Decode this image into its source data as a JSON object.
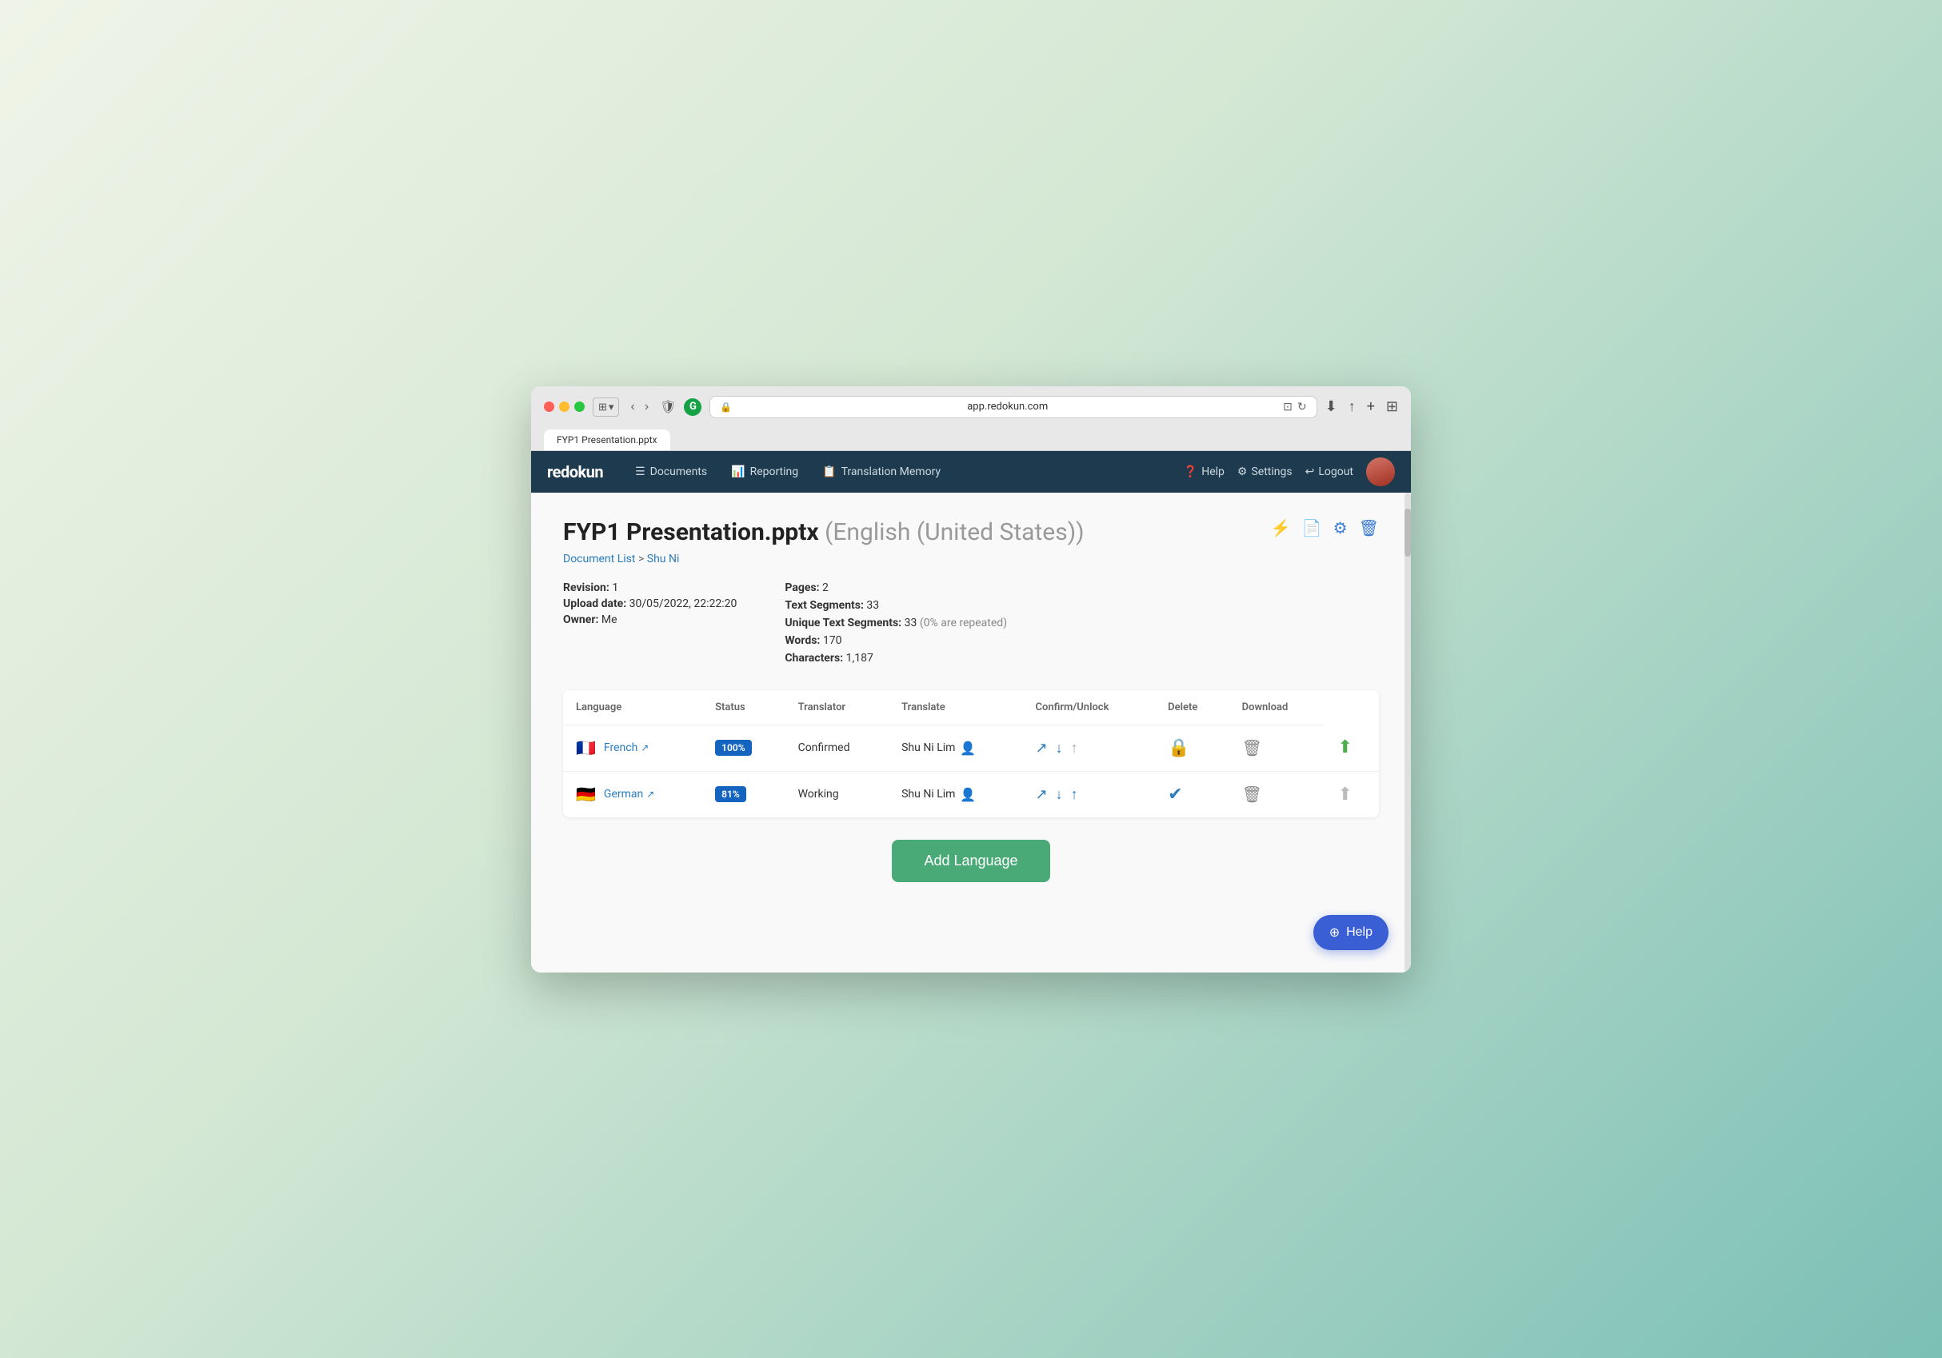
{
  "browser": {
    "url": "app.redokun.com",
    "tab_label": "FYP1 Presentation.pptx"
  },
  "nav": {
    "logo": "redokun",
    "items": [
      {
        "id": "documents",
        "label": "Documents",
        "icon": "☰"
      },
      {
        "id": "reporting",
        "label": "Reporting",
        "icon": "📊"
      },
      {
        "id": "translation-memory",
        "label": "Translation Memory",
        "icon": "📋"
      }
    ],
    "right_items": [
      {
        "id": "help",
        "label": "Help",
        "icon": "❓"
      },
      {
        "id": "settings",
        "label": "Settings",
        "icon": "⚙"
      },
      {
        "id": "logout",
        "label": "Logout",
        "icon": "↩"
      }
    ]
  },
  "document": {
    "title": "FYP1 Presentation.pptx",
    "lang_label": "(English (United States))",
    "breadcrumb_list": "Document List",
    "breadcrumb_separator": ">",
    "breadcrumb_user": "Shu Ni",
    "revision_label": "Revision:",
    "revision_value": "1",
    "upload_date_label": "Upload date:",
    "upload_date_value": "30/05/2022, 22:22:20",
    "owner_label": "Owner:",
    "owner_value": "Me",
    "pages_label": "Pages:",
    "pages_value": "2",
    "text_segments_label": "Text Segments:",
    "text_segments_value": "33",
    "unique_label": "Unique Text Segments:",
    "unique_value": "33",
    "unique_muted": "(0% are repeated)",
    "words_label": "Words:",
    "words_value": "170",
    "characters_label": "Characters:",
    "characters_value": "1,187"
  },
  "table": {
    "headers": [
      "Language",
      "Status",
      "Translator",
      "Translate",
      "Confirm/Unlock",
      "Delete",
      "Download"
    ],
    "rows": [
      {
        "id": "french",
        "flag": "🇫🇷",
        "language": "French",
        "badge": "100%",
        "status": "Confirmed",
        "translator": "Shu Ni Lim",
        "translate_icons": [
          "↗",
          "↓",
          "↑"
        ],
        "confirm_icon": "lock",
        "delete_icon": "🗑",
        "download_color": "green"
      },
      {
        "id": "german",
        "flag": "🇩🇪",
        "language": "German",
        "badge": "81%",
        "status": "Working",
        "translator": "Shu Ni Lim",
        "translate_icons": [
          "↗",
          "↓",
          "↑"
        ],
        "confirm_icon": "check",
        "delete_icon": "🗑",
        "download_color": "gray"
      }
    ]
  },
  "add_language_btn": "Add Language",
  "help_btn": "Help"
}
